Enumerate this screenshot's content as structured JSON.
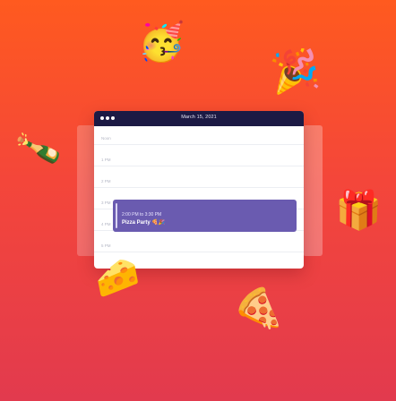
{
  "window": {
    "title": "March 15, 2021",
    "hours": [
      "Noon",
      "1 PM",
      "2 PM",
      "3 PM",
      "4 PM",
      "5 PM"
    ]
  },
  "event": {
    "time": "2:00 PM to 3:30 PM",
    "title": "Pizza Party 🍕🎉"
  },
  "decor": {
    "party_face": "🥳",
    "popper": "🎉",
    "champagne": "🍾",
    "cheese": "🧀",
    "pizza": "🍕",
    "gift": "🎁"
  },
  "colors": {
    "titlebar": "#1c1a44",
    "event": "#6a5bb0",
    "bg_top": "#ff5a1f",
    "bg_bottom": "#e23a4e"
  }
}
